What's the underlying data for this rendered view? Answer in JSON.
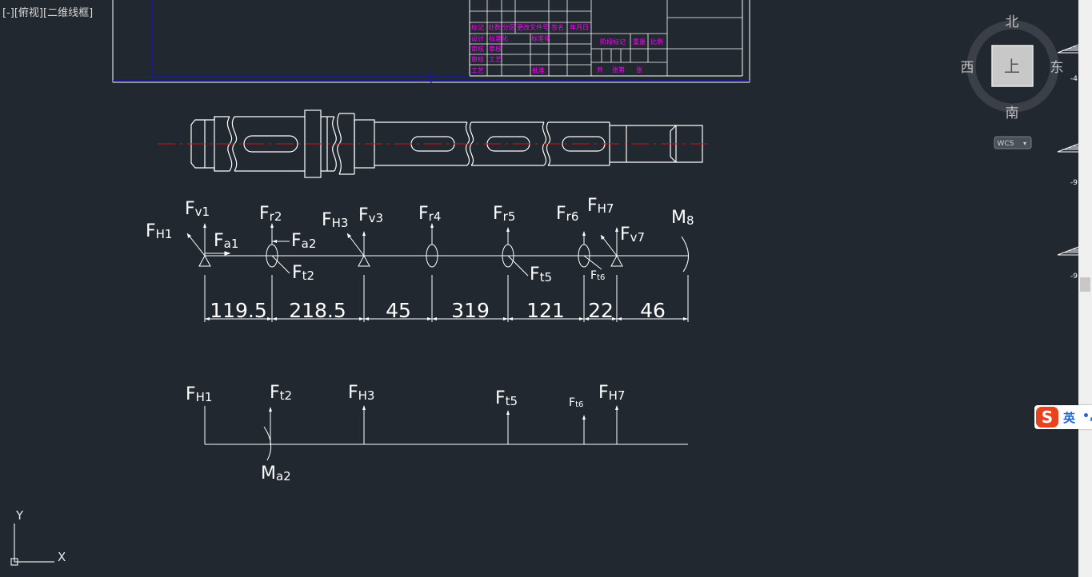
{
  "viewport": {
    "minus": "[-]",
    "view": "[俯视]",
    "style": "[二维线框]"
  },
  "viewcube": {
    "north": "北",
    "south": "南",
    "east": "东",
    "west": "西",
    "face": "上",
    "wcs": "WCS"
  },
  "ucs": {
    "y": "Y",
    "x": "X"
  },
  "title_block": [
    "标记",
    "处数",
    "分区",
    "更改文件号",
    "签名",
    "年月日",
    "设计",
    "标准化",
    "阶段标记",
    "重量",
    "比例",
    "审核",
    "工艺",
    "批准",
    "共",
    "张第",
    "张"
  ],
  "rulers": {
    "r1": "-4",
    "r2": "-9",
    "r3": "-9"
  },
  "loads_top": [
    {
      "b": "F",
      "s": "v1"
    },
    {
      "b": "F",
      "s": "H1"
    },
    {
      "b": "F",
      "s": "a1"
    },
    {
      "b": "F",
      "s": "r2"
    },
    {
      "b": "F",
      "s": "a2"
    },
    {
      "b": "F",
      "s": "t2"
    },
    {
      "b": "F",
      "s": "H3"
    },
    {
      "b": "F",
      "s": "v3"
    },
    {
      "b": "F",
      "s": "r4"
    },
    {
      "b": "F",
      "s": "r5"
    },
    {
      "b": "F",
      "s": "t5"
    },
    {
      "b": "F",
      "s": "r6"
    },
    {
      "b": "F",
      "s": "t6"
    },
    {
      "b": "F",
      "s": "H7"
    },
    {
      "b": "F",
      "s": "v7"
    },
    {
      "b": "M",
      "s": "8"
    }
  ],
  "dimensions": [
    "119.5",
    "218.5",
    "45",
    "319",
    "121",
    "22",
    "46"
  ],
  "loads_bottom": [
    {
      "b": "F",
      "s": "H1"
    },
    {
      "b": "F",
      "s": "t2"
    },
    {
      "b": "M",
      "s": "a2"
    },
    {
      "b": "F",
      "s": "H3"
    },
    {
      "b": "F",
      "s": "t5"
    },
    {
      "b": "F",
      "s": "t6"
    },
    {
      "b": "F",
      "s": "H7"
    }
  ],
  "ime": {
    "logo": "S",
    "lang": "英",
    "dot": "•,"
  },
  "colors": {
    "background": "#212830",
    "lines": "#ffffff",
    "centerline": "#e01010",
    "titleText": "#ff00ff",
    "border": "#1515b8"
  }
}
